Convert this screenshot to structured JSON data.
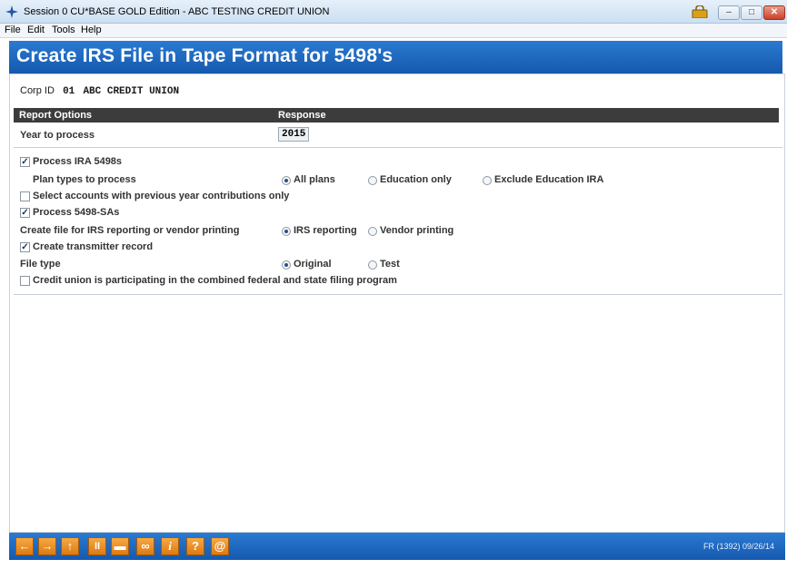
{
  "window": {
    "title": "Session 0 CU*BASE GOLD Edition - ABC TESTING CREDIT UNION",
    "minimize": "–",
    "maximize": "□",
    "close": "✕"
  },
  "menu": [
    "File",
    "Edit",
    "Tools",
    "Help"
  ],
  "header": {
    "title": "Create IRS File in Tape Format for 5498's"
  },
  "corp": {
    "label": "Corp ID",
    "id": "01",
    "name": "ABC CREDIT UNION"
  },
  "options_table": {
    "col1": "Report Options",
    "col2": "Response"
  },
  "year": {
    "label": "Year to process",
    "value": "2015"
  },
  "process_ira": {
    "label": "Process IRA 5498s",
    "checked": true
  },
  "plan_types": {
    "label": "Plan types to process",
    "options": [
      "All plans",
      "Education only",
      "Exclude Education IRA"
    ],
    "selected": 0
  },
  "prev_year": {
    "label": "Select accounts with previous year contributions only",
    "checked": false
  },
  "process_sa": {
    "label": "Process 5498-SAs",
    "checked": true
  },
  "file_for": {
    "label": "Create file for IRS reporting or vendor printing",
    "options": [
      "IRS reporting",
      "Vendor printing"
    ],
    "selected": 0
  },
  "transmitter": {
    "label": "Create transmitter record",
    "checked": true
  },
  "file_type": {
    "label": "File type",
    "options": [
      "Original",
      "Test"
    ],
    "selected": 0
  },
  "combined": {
    "label": "Credit union is participating in the combined federal and state filing program",
    "checked": false
  },
  "toolbar": {
    "buttons": [
      {
        "name": "back-icon",
        "glyph": "←"
      },
      {
        "name": "forward-icon",
        "glyph": "→"
      },
      {
        "name": "up-icon",
        "glyph": "↑"
      },
      {
        "name": "pause-icon",
        "glyph": "II"
      },
      {
        "name": "print-icon",
        "glyph": "▬"
      },
      {
        "name": "link-icon",
        "glyph": "∞"
      },
      {
        "name": "info-icon",
        "glyph": "i"
      },
      {
        "name": "help-icon",
        "glyph": "?"
      },
      {
        "name": "at-icon",
        "glyph": "@"
      }
    ],
    "status": "FR (1392) 09/26/14"
  }
}
